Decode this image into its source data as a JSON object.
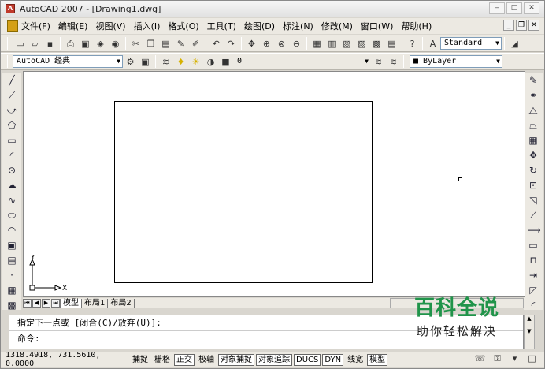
{
  "titlebar": {
    "title": "AutoCAD 2007 - [Drawing1.dwg]"
  },
  "window_buttons": {
    "minimize": "‒",
    "maximize": "□",
    "close": "✕"
  },
  "menu": [
    "文件(F)",
    "编辑(E)",
    "视图(V)",
    "插入(I)",
    "格式(O)",
    "工具(T)",
    "绘图(D)",
    "标注(N)",
    "修改(M)",
    "窗口(W)",
    "帮助(H)"
  ],
  "mdi_buttons": {
    "minimize": "_",
    "restore": "❐",
    "close": "✕"
  },
  "toolbar_standard": {
    "text_style": "Standard"
  },
  "toolbar_workspace": {
    "workspace": "AutoCAD 经典",
    "layer": "0",
    "color": "ByLayer"
  },
  "tabs": {
    "model": "模型",
    "layout1": "布局1",
    "layout2": "布局2"
  },
  "ucs": {
    "x_label": "X",
    "y_label": "Y"
  },
  "command": {
    "history_line": "指定下一点或 [闭合(C)/放弃(U)]:",
    "prompt": "命令:"
  },
  "status": {
    "coords": "1318.4918, 731.5610, 0.0000",
    "buttons": [
      {
        "label": "捕捉",
        "on": false
      },
      {
        "label": "栅格",
        "on": false
      },
      {
        "label": "正交",
        "on": true
      },
      {
        "label": "极轴",
        "on": false
      },
      {
        "label": "对象捕捉",
        "on": true
      },
      {
        "label": "对象追踪",
        "on": true
      },
      {
        "label": "DUCS",
        "on": true
      },
      {
        "label": "DYN",
        "on": true
      },
      {
        "label": "线宽",
        "on": false
      },
      {
        "label": "模型",
        "on": true
      }
    ]
  },
  "watermark": {
    "line1": "百科全说",
    "line2": "助你轻松解决"
  },
  "colors": {
    "accent_green": "#20944a",
    "canvas": "#ffffff",
    "chrome": "#ece9e2"
  }
}
